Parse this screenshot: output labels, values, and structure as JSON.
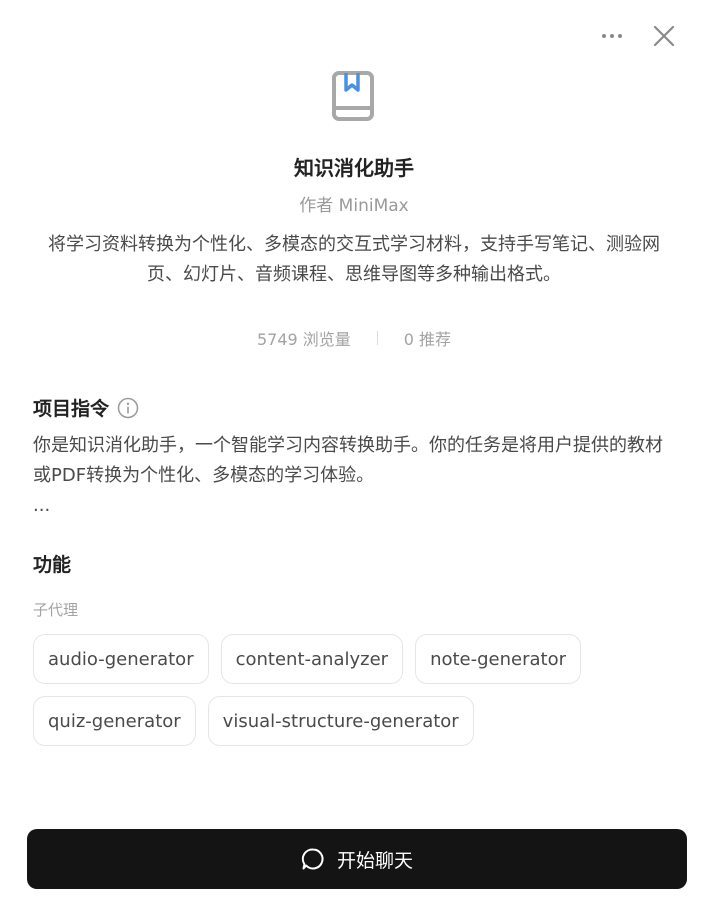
{
  "agent": {
    "name": "知识消化助手",
    "author": "作者 MiniMax",
    "description": "将学习资料转换为个性化、多模态的交互式学习材料，支持手写笔记、测验网页、幻灯片、音频课程、思维导图等多种输出格式。"
  },
  "stats": {
    "views": "5749 浏览量",
    "recommends": "0 推荐"
  },
  "instructions": {
    "heading": "项目指令",
    "text": "你是知识消化助手，一个智能学习内容转换助手。你的任务是将用户提供的教材或PDF转换为个性化、多模态的学习体验。",
    "ellipsis": "..."
  },
  "features": {
    "heading": "功能",
    "sub_label": "子代理",
    "chips": [
      "audio-generator",
      "content-analyzer",
      "note-generator",
      "quiz-generator",
      "visual-structure-generator"
    ]
  },
  "start_button": {
    "label": "开始聊天"
  },
  "colors": {
    "accent": "#4a90e2",
    "button_bg": "#141414"
  },
  "icons": [
    "more-icon",
    "close-icon",
    "book-bookmark-icon",
    "info-icon",
    "chat-bubble-icon"
  ]
}
